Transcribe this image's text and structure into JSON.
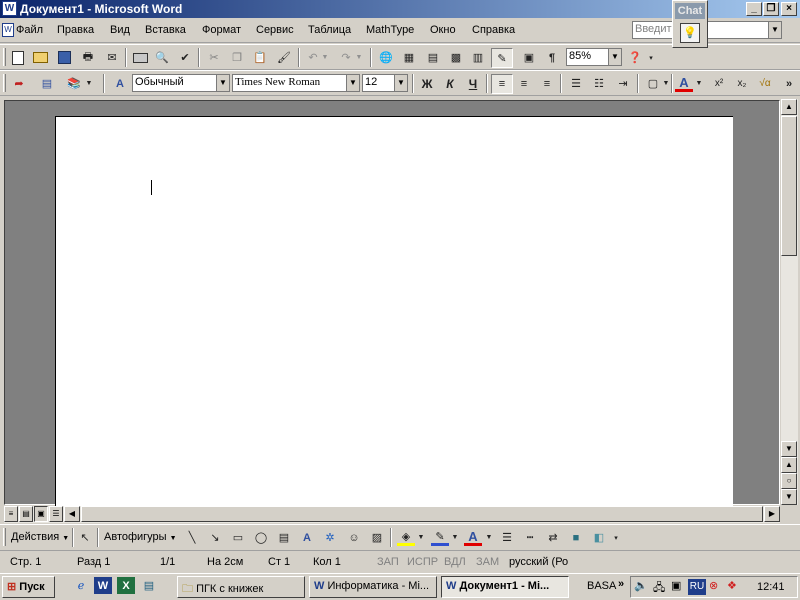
{
  "window": {
    "title": "Документ1 - Microsoft Word",
    "app_icon": "word-doc-icon",
    "controls": {
      "minimize": "_",
      "restore": "❐",
      "close": "×"
    }
  },
  "chat": {
    "label": "Chat",
    "icon": "lightbulb-icon"
  },
  "menu": {
    "items": [
      "Файл",
      "Правка",
      "Вид",
      "Вставка",
      "Формат",
      "Сервис",
      "Таблица",
      "MathType",
      "Окно",
      "Справка"
    ],
    "ask_placeholder": "Введит           ос"
  },
  "standard_toolbar": {
    "zoom": "85%"
  },
  "formatting_toolbar": {
    "style": "Обычный",
    "font": "Times New Roman",
    "size": "12",
    "bold": "Ж",
    "italic": "К",
    "underline": "Ч",
    "font_color_letter": "A"
  },
  "drawing_toolbar": {
    "actions": "Действия",
    "autoshapes": "Автофигуры"
  },
  "status": {
    "page": "Стр.  1",
    "section": "Разд  1",
    "pages": "1/1",
    "at": "На  2см",
    "line": "Ст  1",
    "col": "Кол  1",
    "rec": "ЗАП",
    "trk": "ИСПР",
    "ext": "ВДЛ",
    "ovr": "ЗАМ",
    "lang": "русский (Ро"
  },
  "taskbar": {
    "start": "Пуск",
    "tasks": [
      "ПГК с книжек",
      "Информатика - Mi...",
      "Документ1 - Mi..."
    ],
    "basa": "BASA",
    "lang_indicator": "RU",
    "clock": "12:41"
  },
  "colors": {
    "title_start": "#0a246a",
    "title_end": "#a6caf0",
    "chrome": "#d4d0c8",
    "workspace": "#808080",
    "font_color_underline": "#e00000",
    "highlight_underline": "#ffff00",
    "line_color_underline": "#3050d0"
  }
}
